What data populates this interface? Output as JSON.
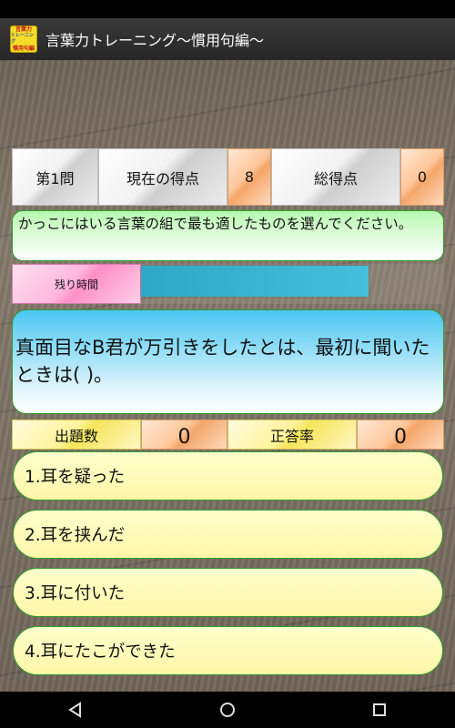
{
  "app": {
    "title": "言葉力トレーニング〜慣用句編〜",
    "icon_line1": "言葉力",
    "icon_line2": "トレーニング",
    "icon_line3": "慣用句編"
  },
  "score": {
    "question_label": "第1問",
    "current_score_label": "現在の得点",
    "current_score_value": "8",
    "total_score_label": "総得点",
    "total_score_value": "0"
  },
  "instruction": "かっこにはいる言葉の組で最も適したものを選んでください。",
  "timer": {
    "label": "残り時間",
    "remaining_fraction": 0.75
  },
  "question_text": "真面目なB君が万引きをしたとは、最初に聞いたときは( )。",
  "stats": {
    "count_label": "出題数",
    "count_value": "0",
    "rate_label": "正答率",
    "rate_value": "0"
  },
  "answers": [
    "1.耳を疑った",
    "2.耳を挟んだ",
    "3.耳に付いた",
    "4.耳にたこができた"
  ],
  "nav": {
    "back_icon": "back-triangle-icon",
    "home_icon": "home-circle-icon",
    "recents_icon": "recents-square-icon"
  }
}
